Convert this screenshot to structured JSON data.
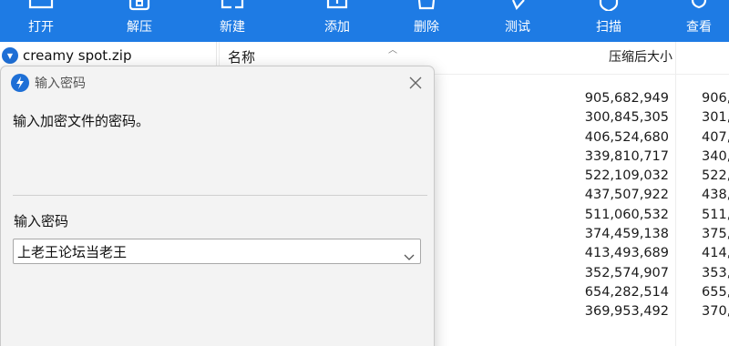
{
  "toolbar": {
    "items": [
      {
        "label": "打开",
        "icon": "folder-open-icon"
      },
      {
        "label": "解压",
        "icon": "extract-icon"
      },
      {
        "label": "新建",
        "icon": "new-archive-icon"
      },
      {
        "label": "添加",
        "icon": "add-icon"
      },
      {
        "label": "删除",
        "icon": "delete-icon"
      },
      {
        "label": "测试",
        "icon": "test-icon"
      },
      {
        "label": "扫描",
        "icon": "scan-shield-icon"
      },
      {
        "label": "查看",
        "icon": "view-icon"
      }
    ],
    "background": "#1e7be4"
  },
  "tree": {
    "root_label": "creamy spot.zip"
  },
  "list": {
    "columns": {
      "name": "名称",
      "packed_size": "压缩后大小"
    },
    "rows": [
      {
        "packed": "905,682,949",
        "size": "906,"
      },
      {
        "packed": "300,845,305",
        "size": "301,"
      },
      {
        "packed": "406,524,680",
        "size": "407,"
      },
      {
        "packed": "339,810,717",
        "size": "340,"
      },
      {
        "packed": "522,109,032",
        "size": "522,"
      },
      {
        "packed": "437,507,922",
        "size": "438,"
      },
      {
        "packed": "511,060,532",
        "size": "511,"
      },
      {
        "packed": "374,459,138",
        "size": "375,"
      },
      {
        "packed": "413,493,689",
        "size": "414,"
      },
      {
        "packed": "352,574,907",
        "size": "353,"
      },
      {
        "packed": "654,282,514",
        "size": "655,"
      },
      {
        "packed": "369,953,492",
        "size": "370,"
      }
    ]
  },
  "dialog": {
    "title": "输入密码",
    "message": "输入加密文件的密码。",
    "field_label": "输入密码",
    "password_value": "上老王论坛当老王"
  }
}
